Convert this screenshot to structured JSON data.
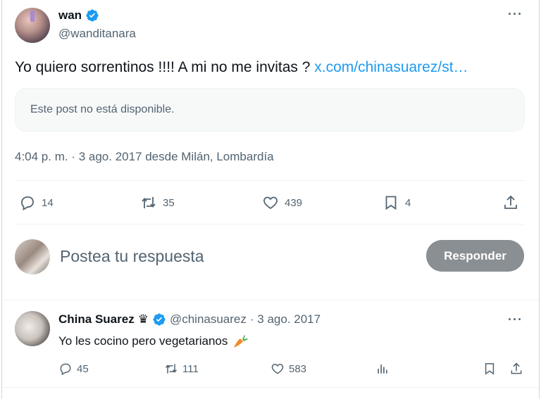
{
  "colors": {
    "accent": "#1d9bf0",
    "muted": "#536471",
    "reply_button": "#8a8f93",
    "carrot": "#f28b2a"
  },
  "main_tweet": {
    "display_name": "wan",
    "handle": "@wanditanara",
    "text": "Yo quiero sorrentinos !!!! A mi no me invitas ? ",
    "link_text": "x.com/chinasuarez/st…",
    "quoted_unavailable": "Este post no está disponible.",
    "timestamp": "4:04 p. m. · 3 ago. 2017 desde Milán, Lombardía",
    "stats": {
      "replies": "14",
      "reposts": "35",
      "likes": "439",
      "bookmarks": "4"
    },
    "icons": [
      "verified-badge-icon",
      "more-icon",
      "reply-icon",
      "retweet-icon",
      "heart-icon",
      "bookmark-icon",
      "share-icon"
    ]
  },
  "composer": {
    "placeholder": "Postea tu respuesta",
    "button_label": "Responder"
  },
  "reply_tweet": {
    "display_name": "China Suarez",
    "crown": "♛",
    "handle": "@chinasuarez",
    "date": "· 3 ago. 2017",
    "text": "Yo les cocino pero vegetarianos",
    "emoji_icon": "carrot-icon",
    "stats": {
      "replies": "45",
      "reposts": "111",
      "likes": "583"
    },
    "icons": [
      "reply-icon",
      "retweet-icon",
      "heart-icon",
      "analytics-icon",
      "bookmark-icon",
      "share-icon"
    ]
  }
}
